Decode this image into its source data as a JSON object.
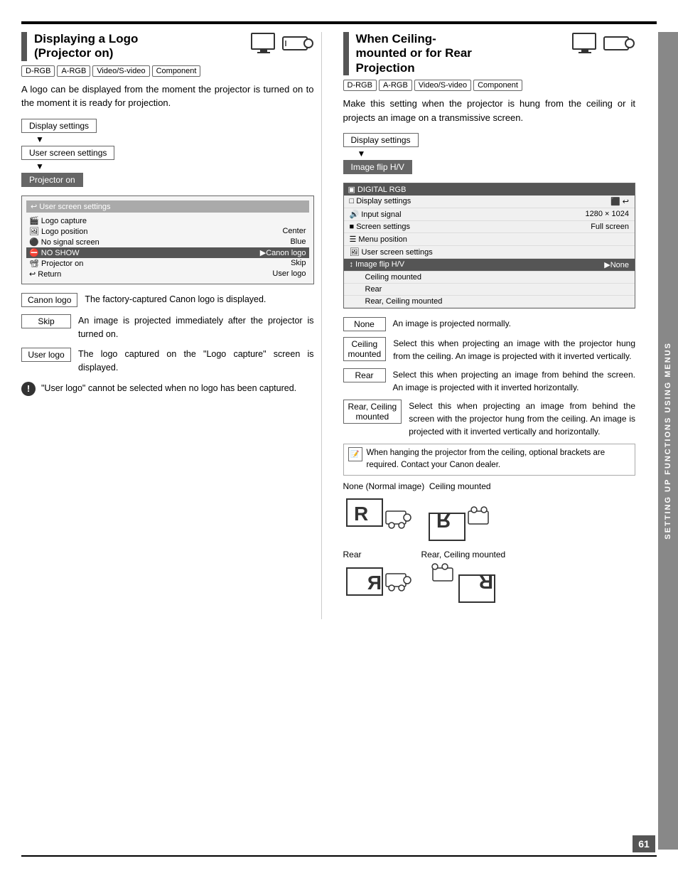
{
  "page": {
    "page_number": "61",
    "top_border": true,
    "bottom_border": true
  },
  "sidebar": {
    "label": "SETTING UP FUNCTIONS USING MENUS"
  },
  "left_section": {
    "title": "Displaying a Logo\n(Projector on)",
    "badges": [
      "D-RGB",
      "A-RGB",
      "Video/S-video",
      "Component"
    ],
    "body_text": "A logo can be displayed from the moment the projector is turned on to the moment it is ready for projection.",
    "nav_items": [
      "Display settings",
      "User screen settings",
      "Projector on"
    ],
    "screen_header": "User screen settings",
    "screen_rows": [
      {
        "label": "Logo capture",
        "value": "",
        "selected": false
      },
      {
        "label": "Logo position",
        "value": "Center",
        "selected": false
      },
      {
        "label": "No signal screen",
        "value": "Blue",
        "selected": false
      },
      {
        "label": "NO SHOW",
        "value": "▶Canon logo",
        "selected": true
      },
      {
        "label": "Projector on",
        "value": "Skip",
        "selected": false
      },
      {
        "label": "Return",
        "value": "User logo",
        "selected": false
      }
    ],
    "options": [
      {
        "tag": "Canon logo",
        "desc": "The factory-captured Canon logo is displayed."
      },
      {
        "tag": "Skip",
        "desc": "An image is projected immediately after the projector is turned on."
      },
      {
        "tag": "User logo",
        "desc": "The logo captured on the \"Logo capture\" screen is displayed."
      }
    ],
    "note": {
      "icon": "!",
      "text": "\"User logo\" cannot be selected when no logo has been captured."
    }
  },
  "right_section": {
    "title": "When Ceiling-mounted or for Rear Projection",
    "badges": [
      "D-RGB",
      "A-RGB",
      "Video/S-video",
      "Component"
    ],
    "body_text": "Make this setting when the projector is hung from the ceiling or it projects an image on a transmissive screen.",
    "nav_items": [
      "Display settings",
      "Image flip H/V"
    ],
    "screen_title": "DIGITAL RGB",
    "screen_rows": [
      {
        "label": "Display settings",
        "value": "⬛ ↩",
        "selected": false
      },
      {
        "label": "Input signal",
        "value": "1280 × 1024",
        "selected": false
      },
      {
        "label": "Screen settings",
        "value": "Full screen",
        "selected": false
      },
      {
        "label": "Menu position",
        "value": "",
        "selected": false
      },
      {
        "label": "User screen settings",
        "value": "",
        "selected": false
      },
      {
        "label": "Image flip H/V",
        "value": "▶None",
        "selected": true
      },
      {
        "sub": true,
        "label": "Ceiling mounted",
        "value": "",
        "selected": false
      },
      {
        "sub": true,
        "label": "Rear",
        "value": "",
        "selected": false
      },
      {
        "sub": true,
        "label": "Rear, Ceiling mounted",
        "value": "",
        "selected": false
      }
    ],
    "desc_rows": [
      {
        "tag": "None",
        "text": "An image is projected normally."
      },
      {
        "tag": "Ceiling\nmounted",
        "text": "Select this when projecting an image with the projector hung from the ceiling. An image is projected with it inverted vertically."
      },
      {
        "tag": "Rear",
        "text": "Select this when projecting an image from behind the screen. An image is projected with it inverted horizontally."
      },
      {
        "tag": "Rear, Ceiling\nmounted",
        "text": "Select this when projecting an image from behind the screen with the projector hung from the ceiling. An image is projected with it inverted vertically and horizontally."
      }
    ],
    "note_box": {
      "text": "When hanging the projector from the ceiling, optional brackets are required. Contact your Canon dealer."
    },
    "diagrams_label": "None (Normal image)  Ceiling mounted",
    "diagrams": [
      {
        "label": "Rear",
        "type": "rear"
      },
      {
        "label": "Rear, Ceiling mounted",
        "type": "rear_ceiling"
      }
    ]
  }
}
